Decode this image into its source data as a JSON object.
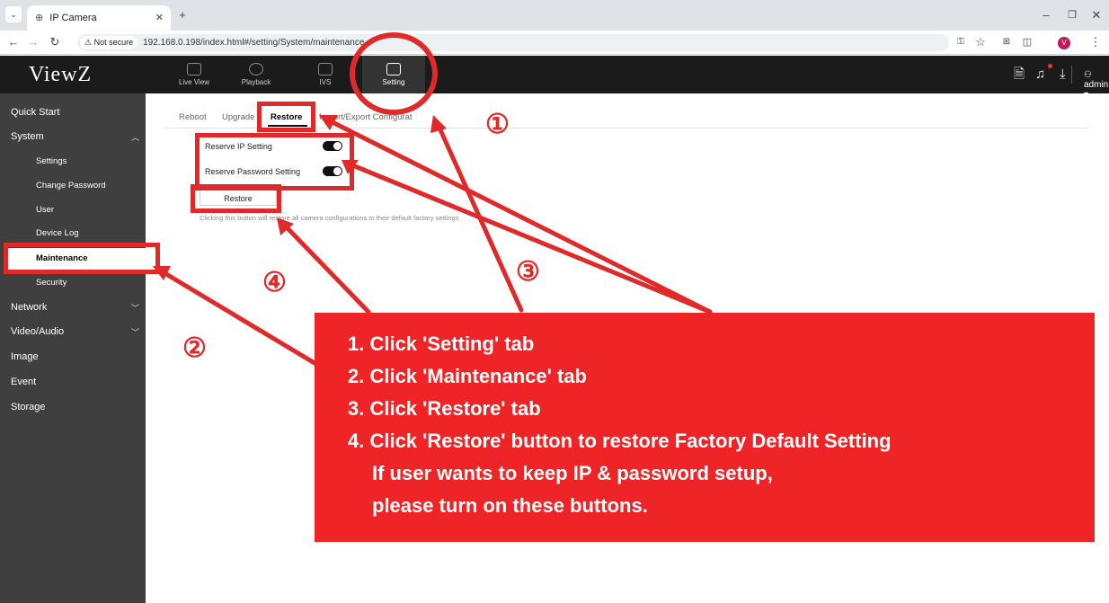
{
  "browser": {
    "tab_title": "IP Camera",
    "new_tab": "+",
    "security_label": "Not secure",
    "url": "192.168.0.198/index.html#/setting/System/maintenance"
  },
  "header": {
    "logo": "ViewZ",
    "nav": [
      "Live View",
      "Playback",
      "IVS",
      "Setting"
    ],
    "user": "admin"
  },
  "sidebar": {
    "items": [
      "Quick Start",
      "System",
      "Network",
      "Video/Audio",
      "Image",
      "Event",
      "Storage"
    ],
    "system_sub": [
      "Settings",
      "Change Password",
      "User",
      "Device Log",
      "Maintenance",
      "Security"
    ]
  },
  "content": {
    "tabs": [
      "Reboot",
      "Upgrade",
      "Restore",
      "Import/Export Configurat"
    ],
    "reserve_ip": "Reserve IP Setting",
    "reserve_pw": "Reserve Password Setting",
    "reserve_ip_on": true,
    "reserve_pw_on": true,
    "restore_button": "Restore",
    "note": "Clicking this button will restore all camera configurations to their default factory settings"
  },
  "annotation": {
    "numbers": [
      "①",
      "②",
      "③",
      "④"
    ],
    "lines": [
      "1. Click 'Setting' tab",
      "2. Click 'Maintenance' tab",
      "3. Click 'Restore' tab",
      "4. Click 'Restore' button to restore Factory Default Setting",
      "If user wants to keep IP & password setup,",
      "please turn on these buttons."
    ],
    "color": "#ee2426"
  }
}
